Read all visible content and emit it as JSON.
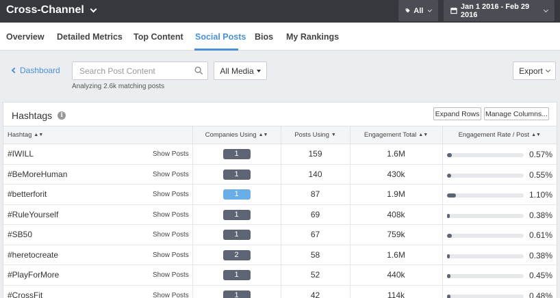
{
  "topbar": {
    "title": "Cross-Channel",
    "filter_label": "All",
    "date_range": "Jan 1 2016 - Feb 29 2016"
  },
  "tabs": [
    {
      "label": "Overview",
      "active": false
    },
    {
      "label": "Detailed Metrics",
      "active": false
    },
    {
      "label": "Top Content",
      "active": false
    },
    {
      "label": "Social Posts",
      "active": true
    },
    {
      "label": "Bios",
      "active": false
    },
    {
      "label": "My Rankings",
      "active": false
    }
  ],
  "toolbar": {
    "back_label": "Dashboard",
    "search_placeholder": "Search Post Content",
    "media_label": "All Media",
    "analyzing_text": "Analyzing 2.6k matching posts",
    "export_label": "Export"
  },
  "panel": {
    "title": "Hashtags",
    "expand_label": "Expand Rows",
    "manage_label": "Manage Columns..."
  },
  "table": {
    "columns": [
      "Hashtag",
      "Companies Using",
      "Posts Using",
      "Engagement Total",
      "Engagement Rate / Post"
    ],
    "show_posts_label": "Show Posts",
    "rows": [
      {
        "hashtag": "#IWILL",
        "companies": "1",
        "posts": "159",
        "engagement": "1.6M",
        "rate": "0.57%",
        "rate_fraction": 0.057,
        "highlight": false
      },
      {
        "hashtag": "#BeMoreHuman",
        "companies": "1",
        "posts": "140",
        "engagement": "430k",
        "rate": "0.55%",
        "rate_fraction": 0.055,
        "highlight": false
      },
      {
        "hashtag": "#betterforit",
        "companies": "1",
        "posts": "87",
        "engagement": "1.9M",
        "rate": "1.10%",
        "rate_fraction": 0.11,
        "highlight": true
      },
      {
        "hashtag": "#RuleYourself",
        "companies": "1",
        "posts": "69",
        "engagement": "408k",
        "rate": "0.38%",
        "rate_fraction": 0.038,
        "highlight": false
      },
      {
        "hashtag": "#SB50",
        "companies": "1",
        "posts": "67",
        "engagement": "759k",
        "rate": "0.61%",
        "rate_fraction": 0.061,
        "highlight": false
      },
      {
        "hashtag": "#heretocreate",
        "companies": "2",
        "posts": "58",
        "engagement": "1.6M",
        "rate": "0.38%",
        "rate_fraction": 0.038,
        "highlight": false
      },
      {
        "hashtag": "#PlayForMore",
        "companies": "1",
        "posts": "52",
        "engagement": "440k",
        "rate": "0.45%",
        "rate_fraction": 0.045,
        "highlight": false
      },
      {
        "hashtag": "#CrossFit",
        "companies": "1",
        "posts": "42",
        "engagement": "114k",
        "rate": "0.48%",
        "rate_fraction": 0.048,
        "highlight": false
      }
    ]
  },
  "colors": {
    "accent": "#4a90d9",
    "badge": "#5d6473",
    "badge_highlight": "#6aaee8",
    "topbar": "#35383d"
  }
}
